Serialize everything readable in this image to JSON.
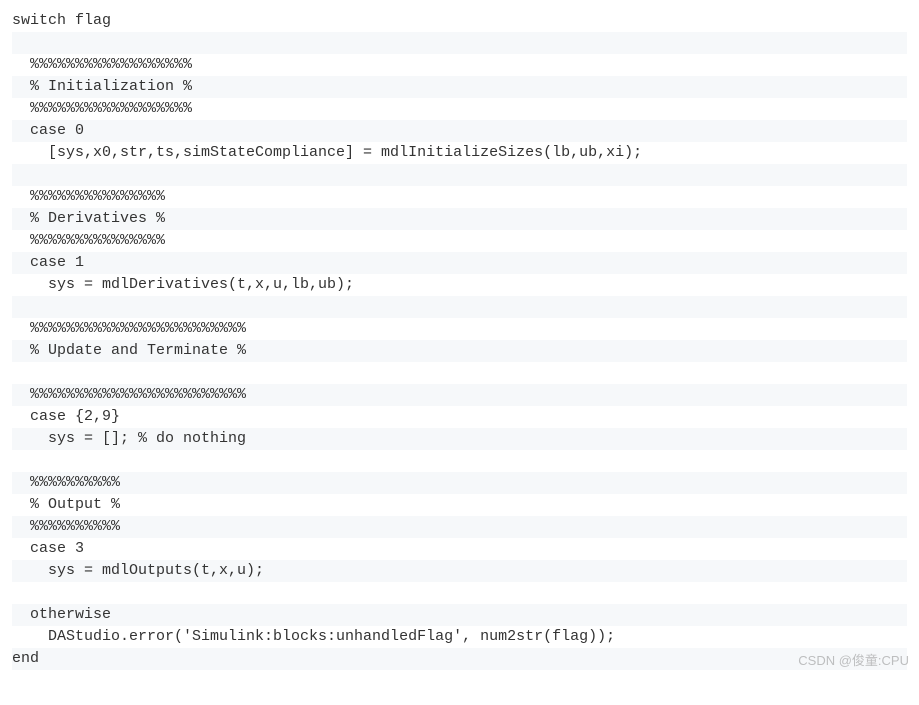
{
  "code": {
    "lines": [
      "switch flag",
      "",
      "  %%%%%%%%%%%%%%%%%%",
      "  % Initialization %",
      "  %%%%%%%%%%%%%%%%%%",
      "  case 0",
      "    [sys,x0,str,ts,simStateCompliance] = mdlInitializeSizes(lb,ub,xi);",
      "",
      "  %%%%%%%%%%%%%%%",
      "  % Derivatives %",
      "  %%%%%%%%%%%%%%%",
      "  case 1",
      "    sys = mdlDerivatives(t,x,u,lb,ub);",
      "",
      "  %%%%%%%%%%%%%%%%%%%%%%%%",
      "  % Update and Terminate %",
      "",
      "  %%%%%%%%%%%%%%%%%%%%%%%%",
      "  case {2,9}",
      "    sys = []; % do nothing",
      "",
      "  %%%%%%%%%%",
      "  % Output %",
      "  %%%%%%%%%%",
      "  case 3",
      "    sys = mdlOutputs(t,x,u);",
      "",
      "  otherwise",
      "    DAStudio.error('Simulink:blocks:unhandledFlag', num2str(flag));",
      "end"
    ]
  },
  "watermark": "CSDN @俊童:CPU"
}
